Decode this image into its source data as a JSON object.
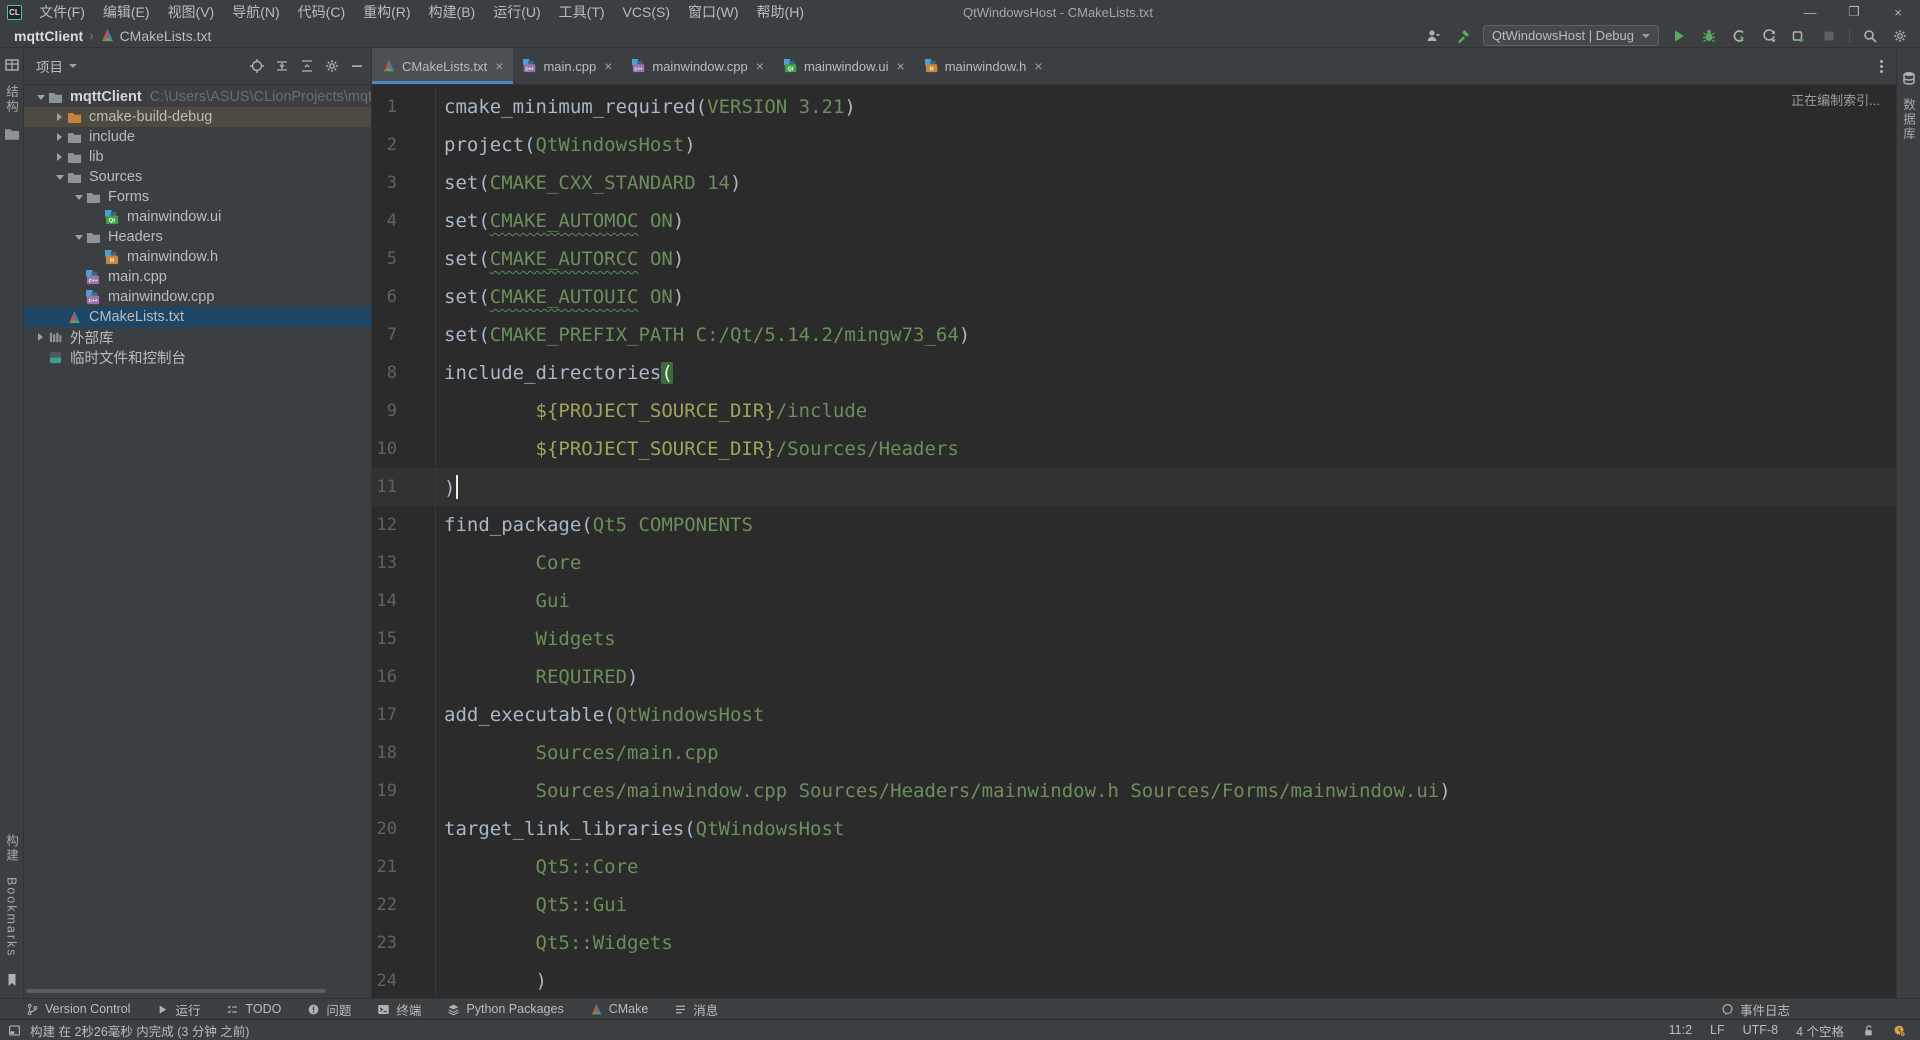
{
  "colors": {
    "panel_bg": "#3C3F41",
    "editor_bg": "#2B2B2B",
    "selection_blue": "#1C4566",
    "active_tab_underline": "#4A88C7",
    "run_green": "#5BA75B",
    "excluded_row": "#4C4A41",
    "cmake_command": "#A9B7C6",
    "cmake_argument": "#6B8F5A",
    "cmake_variable": "#A0A35C",
    "line_number": "#606366",
    "current_line": "#323232",
    "notification_yellow": "#D9A343"
  },
  "title_bar": {
    "app_logo": "CL",
    "menus": [
      "文件(F)",
      "编辑(E)",
      "视图(V)",
      "导航(N)",
      "代码(C)",
      "重构(R)",
      "构建(B)",
      "运行(U)",
      "工具(T)",
      "VCS(S)",
      "窗口(W)",
      "帮助(H)"
    ],
    "window_title": "QtWindowsHost - CMakeLists.txt",
    "window_buttons": [
      "minimize",
      "maximize",
      "close"
    ]
  },
  "toolbar": {
    "breadcrumb": {
      "project": "mqttClient",
      "separator": "›",
      "file": "CMakeLists.txt"
    },
    "run_config": "QtWindowsHost | Debug"
  },
  "left_stripe": {
    "structure_label": "结构",
    "build_label": "构建",
    "bookmarks_label": "Bookmarks"
  },
  "right_stripe": {
    "database_label": "数据库"
  },
  "project_panel": {
    "title": "项目",
    "tree": [
      {
        "label": "mqttClient",
        "path": "C:\\Users\\ASUS\\CLionProjects\\mqttClien",
        "icon": "folder",
        "chevron": "down",
        "indent": 0,
        "bold": true
      },
      {
        "label": "cmake-build-debug",
        "icon": "folder-excluded",
        "chevron": "right",
        "indent": 1,
        "row": "excluded"
      },
      {
        "label": "include",
        "icon": "folder",
        "chevron": "right",
        "indent": 1
      },
      {
        "label": "lib",
        "icon": "folder",
        "chevron": "right",
        "indent": 1
      },
      {
        "label": "Sources",
        "icon": "folder",
        "chevron": "down",
        "indent": 1
      },
      {
        "label": "Forms",
        "icon": "folder",
        "chevron": "down",
        "indent": 2
      },
      {
        "label": "mainwindow.ui",
        "icon": "qt",
        "chevron": "none",
        "indent": 3
      },
      {
        "label": "Headers",
        "icon": "folder",
        "chevron": "down",
        "indent": 2
      },
      {
        "label": "mainwindow.h",
        "icon": "hfile",
        "chevron": "none",
        "indent": 3
      },
      {
        "label": "main.cpp",
        "icon": "cpp",
        "chevron": "none",
        "indent": 2
      },
      {
        "label": "mainwindow.cpp",
        "icon": "cpp",
        "chevron": "none",
        "indent": 2
      },
      {
        "label": "CMakeLists.txt",
        "icon": "cmake",
        "chevron": "none",
        "indent": 1,
        "selected": true
      },
      {
        "label": "外部库",
        "icon": "extlib",
        "chevron": "right",
        "indent": 0
      },
      {
        "label": "临时文件和控制台",
        "icon": "scratch",
        "chevron": "none",
        "indent": 0
      }
    ]
  },
  "editor": {
    "tabs": [
      {
        "label": "CMakeLists.txt",
        "icon": "cmake",
        "active": true
      },
      {
        "label": "main.cpp",
        "icon": "cpp",
        "active": false
      },
      {
        "label": "mainwindow.cpp",
        "icon": "cpp",
        "active": false
      },
      {
        "label": "mainwindow.ui",
        "icon": "qt",
        "active": false
      },
      {
        "label": "mainwindow.h",
        "icon": "hfile",
        "active": false
      }
    ],
    "indexing_label": "正在编制索引...",
    "lines": [
      {
        "n": 1,
        "seg": [
          [
            "c",
            "cmake_minimum_required"
          ],
          [
            "p",
            "("
          ],
          [
            "a",
            "VERSION 3.21"
          ],
          [
            "p",
            ")"
          ]
        ]
      },
      {
        "n": 2,
        "seg": [
          [
            "c",
            "project"
          ],
          [
            "p",
            "("
          ],
          [
            "a",
            "QtWindowsHost"
          ],
          [
            "p",
            ")"
          ]
        ]
      },
      {
        "n": 3,
        "seg": [
          [
            "c",
            "set"
          ],
          [
            "p",
            "("
          ],
          [
            "a",
            "CMAKE_CXX_STANDARD 14"
          ],
          [
            "p",
            ")"
          ]
        ]
      },
      {
        "n": 4,
        "seg": [
          [
            "c",
            "set"
          ],
          [
            "p",
            "("
          ],
          [
            "e",
            "CMAKE_AUTOMOC"
          ],
          [
            "a",
            " ON"
          ],
          [
            "p",
            ")"
          ]
        ]
      },
      {
        "n": 5,
        "seg": [
          [
            "c",
            "set"
          ],
          [
            "p",
            "("
          ],
          [
            "e",
            "CMAKE_AUTORCC"
          ],
          [
            "a",
            " ON"
          ],
          [
            "p",
            ")"
          ]
        ]
      },
      {
        "n": 6,
        "seg": [
          [
            "c",
            "set"
          ],
          [
            "p",
            "("
          ],
          [
            "e",
            "CMAKE_AUTOUIC"
          ],
          [
            "a",
            " ON"
          ],
          [
            "p",
            ")"
          ]
        ]
      },
      {
        "n": 7,
        "seg": [
          [
            "c",
            "set"
          ],
          [
            "p",
            "("
          ],
          [
            "a",
            "CMAKE_PREFIX_PATH C:/Qt/5.14.2/mingw73_64"
          ],
          [
            "p",
            ")"
          ]
        ]
      },
      {
        "n": 8,
        "seg": [
          [
            "c",
            "include_directories"
          ],
          [
            "m",
            "("
          ]
        ]
      },
      {
        "n": 9,
        "seg": [
          [
            "p",
            "        "
          ],
          [
            "v",
            "${PROJECT_SOURCE_DIR}"
          ],
          [
            "a",
            "/include"
          ]
        ]
      },
      {
        "n": 10,
        "seg": [
          [
            "p",
            "        "
          ],
          [
            "v",
            "${PROJECT_SOURCE_DIR}"
          ],
          [
            "a",
            "/Sources/Headers"
          ]
        ]
      },
      {
        "n": 11,
        "seg": [
          [
            "p",
            ")"
          ]
        ],
        "cur": true,
        "caret": true
      },
      {
        "n": 12,
        "seg": [
          [
            "c",
            "find_package"
          ],
          [
            "p",
            "("
          ],
          [
            "a",
            "Qt5 COMPONENTS"
          ]
        ]
      },
      {
        "n": 13,
        "seg": [
          [
            "p",
            "        "
          ],
          [
            "a",
            "Core"
          ]
        ]
      },
      {
        "n": 14,
        "seg": [
          [
            "p",
            "        "
          ],
          [
            "a",
            "Gui"
          ]
        ]
      },
      {
        "n": 15,
        "seg": [
          [
            "p",
            "        "
          ],
          [
            "a",
            "Widgets"
          ]
        ]
      },
      {
        "n": 16,
        "seg": [
          [
            "p",
            "        "
          ],
          [
            "a",
            "REQUIRED"
          ],
          [
            "p",
            ")"
          ]
        ]
      },
      {
        "n": 17,
        "seg": [
          [
            "c",
            "add_executable"
          ],
          [
            "p",
            "("
          ],
          [
            "a",
            "QtWindowsHost"
          ]
        ]
      },
      {
        "n": 18,
        "seg": [
          [
            "p",
            "        "
          ],
          [
            "a",
            "Sources/main.cpp"
          ]
        ]
      },
      {
        "n": 19,
        "seg": [
          [
            "p",
            "        "
          ],
          [
            "a",
            "Sources/mainwindow.cpp Sources/Headers/mainwindow.h Sources/Forms/mainwindow.ui"
          ],
          [
            "p",
            ")"
          ]
        ]
      },
      {
        "n": 20,
        "seg": [
          [
            "c",
            "target_link_libraries"
          ],
          [
            "p",
            "("
          ],
          [
            "a",
            "QtWindowsHost"
          ]
        ]
      },
      {
        "n": 21,
        "seg": [
          [
            "p",
            "        "
          ],
          [
            "a",
            "Qt5::Core"
          ]
        ]
      },
      {
        "n": 22,
        "seg": [
          [
            "p",
            "        "
          ],
          [
            "a",
            "Qt5::Gui"
          ]
        ]
      },
      {
        "n": 23,
        "seg": [
          [
            "p",
            "        "
          ],
          [
            "a",
            "Qt5::Widgets"
          ]
        ]
      },
      {
        "n": 24,
        "seg": [
          [
            "p",
            "        )"
          ]
        ]
      }
    ]
  },
  "bottom_bar": {
    "items": [
      {
        "icon": "branch",
        "label": "Version Control"
      },
      {
        "icon": "play-small",
        "label": "运行"
      },
      {
        "icon": "todo",
        "label": "TODO"
      },
      {
        "icon": "error",
        "label": "问题"
      },
      {
        "icon": "terminal",
        "label": "终端"
      },
      {
        "icon": "layers",
        "label": "Python Packages"
      },
      {
        "icon": "cmake",
        "label": "CMake"
      },
      {
        "icon": "msg",
        "label": "消息"
      }
    ],
    "event_log_label": "事件日志"
  },
  "status_bar": {
    "message": "构建 在 2秒26毫秒 内完成 (3 分钟 之前)",
    "caret_position": "11:2",
    "line_separator": "LF",
    "encoding": "UTF-8",
    "indent_style": "4 个空格"
  }
}
